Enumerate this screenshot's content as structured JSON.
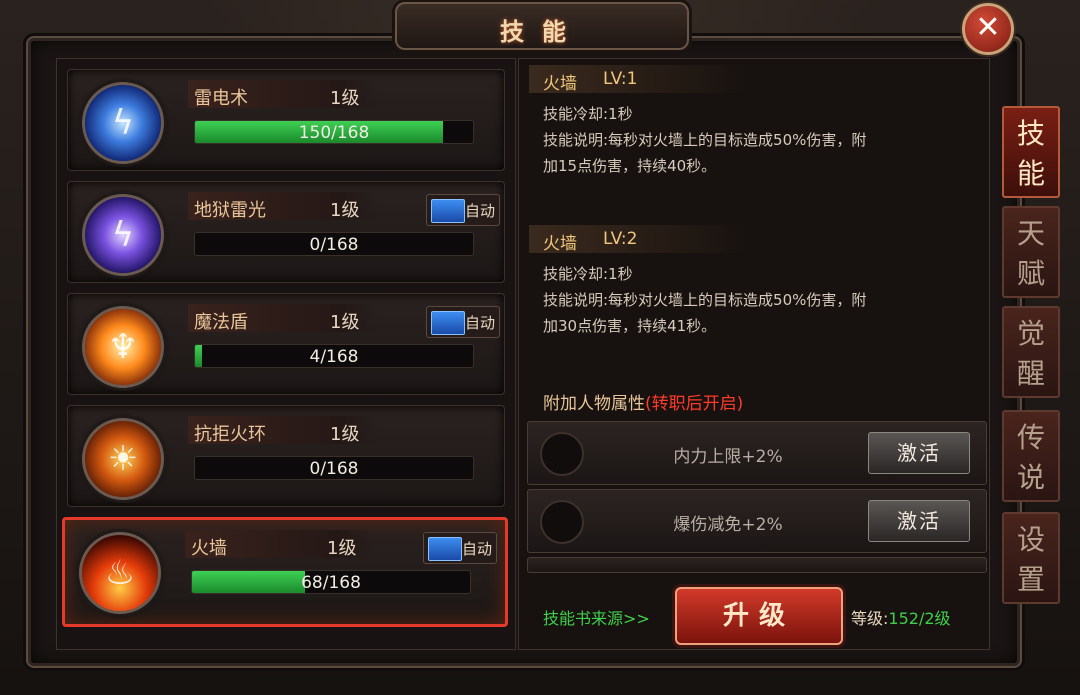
{
  "window": {
    "title": "技能",
    "close_icon": "✕"
  },
  "skills": [
    {
      "name": "雷电术",
      "level": "1级",
      "progress": "150/168",
      "progress_fraction": 0.893,
      "auto": false,
      "icon": "lightning-skill-icon"
    },
    {
      "name": "地狱雷光",
      "level": "1级",
      "progress": "0/168",
      "progress_fraction": 0.0,
      "auto": true,
      "auto_label": "自动",
      "icon": "hell-thunder-skill-icon"
    },
    {
      "name": "魔法盾",
      "level": "1级",
      "progress": "4/168",
      "progress_fraction": 0.024,
      "auto": true,
      "auto_label": "自动",
      "icon": "magic-shield-skill-icon"
    },
    {
      "name": "抗拒火环",
      "level": "1级",
      "progress": "0/168",
      "progress_fraction": 0.0,
      "auto": false,
      "icon": "fire-ring-skill-icon"
    },
    {
      "name": "火墙",
      "level": "1级",
      "progress": "68/168",
      "progress_fraction": 0.405,
      "auto": true,
      "auto_label": "自动",
      "icon": "fire-wall-skill-icon",
      "selected": true
    }
  ],
  "detail": {
    "lv1": {
      "name": "火墙",
      "level": "LV:1",
      "line1": "技能冷却:1秒",
      "line2": "技能说明:每秒对火墙上的目标造成50%伤害，附",
      "line3": "加15点伤害，持续40秒。"
    },
    "lv2": {
      "name": "火墙",
      "level": "LV:2",
      "line1": "技能冷却:1秒",
      "line2": "技能说明:每秒对火墙上的目标造成50%伤害，附",
      "line3": "加30点伤害，持续41秒。"
    },
    "attr_title": "附加人物属性",
    "attr_note": "(转职后开启)",
    "attrs": [
      {
        "text": "内力上限+2%",
        "button": "激活"
      },
      {
        "text": "爆伤减免+2%",
        "button": "激活"
      }
    ],
    "source_link": "技能书来源>>",
    "upgrade_button": "升级",
    "grade_label": "等级:",
    "grade_value": "152/2级"
  },
  "tabs": [
    {
      "label": "技能",
      "active": true
    },
    {
      "label": "天赋",
      "active": false
    },
    {
      "label": "觉醒",
      "active": false
    },
    {
      "label": "传说",
      "active": false
    },
    {
      "label": "设置",
      "active": false
    }
  ],
  "colors": {
    "accent_red": "#e53a2a",
    "progress_green": "#3ed054",
    "text_gold": "#f0c77a",
    "link_green": "#3fcf4a"
  }
}
